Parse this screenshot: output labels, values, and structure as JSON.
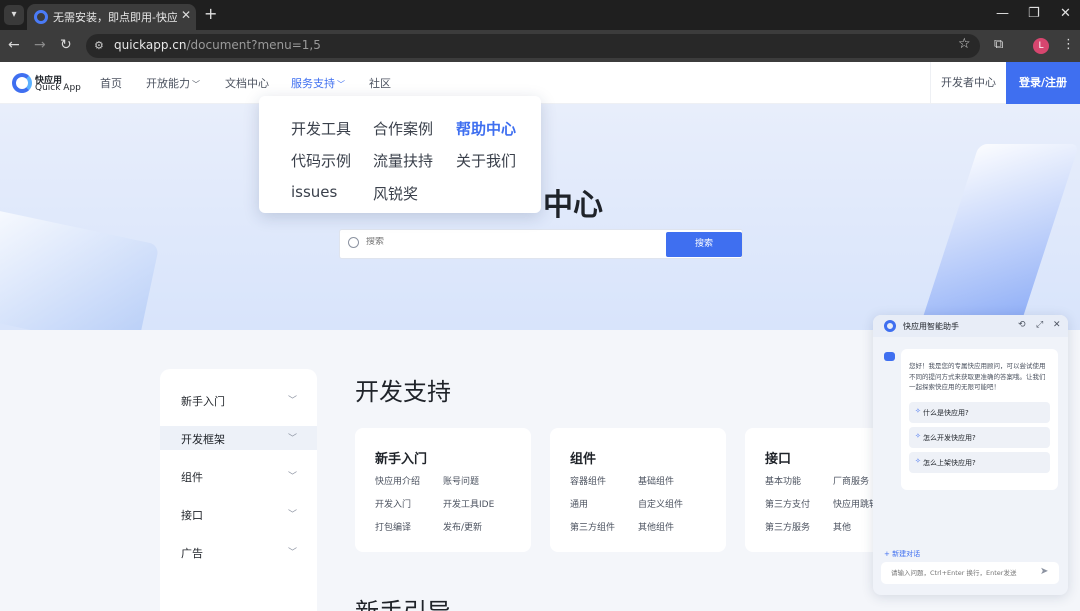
{
  "browser": {
    "tab_title": "无需安装，即点即用-快应用联",
    "url_host": "quickapp.cn",
    "url_path": "/document?menu=1,5",
    "avatar_letter": "L"
  },
  "header": {
    "logo_cn": "快应用",
    "logo_en": "Quick App",
    "nav": [
      {
        "label": "首页",
        "caret": false
      },
      {
        "label": "开放能力",
        "caret": true
      },
      {
        "label": "文档中心",
        "caret": false
      },
      {
        "label": "服务支持",
        "caret": true,
        "active": true
      },
      {
        "label": "社区",
        "caret": false
      }
    ],
    "dev_center": "开发者中心",
    "login": "登录/注册"
  },
  "dropdown": {
    "items": [
      "开发工具",
      "合作案例",
      "帮助中心",
      "代码示例",
      "流量扶持",
      "关于我们",
      "issues",
      "风锐奖"
    ],
    "active_index": 2
  },
  "hero": {
    "title_visible": "中心",
    "search_placeholder": "搜索",
    "search_button": "搜索"
  },
  "sidebar": {
    "items": [
      "新手入门",
      "开发框架",
      "组件",
      "接口",
      "广告"
    ],
    "active_index": 1
  },
  "main": {
    "section_title": "开发支持",
    "section2_title": "新手引导",
    "cards": [
      {
        "title": "新手入门",
        "links": [
          "快应用介绍",
          "账号问题",
          "开发入门",
          "开发工具IDE",
          "打包编译",
          "发布/更新"
        ]
      },
      {
        "title": "组件",
        "links": [
          "容器组件",
          "基础组件",
          "通用",
          "自定义组件",
          "第三方组件",
          "其他组件"
        ]
      },
      {
        "title": "接口",
        "links": [
          "基本功能",
          "厂商服务",
          "第三方支付",
          "快应用跳转",
          "第三方服务",
          "其他"
        ]
      }
    ]
  },
  "assistant": {
    "title": "快应用智能助手",
    "greeting": "您好！我是您的专属快应用顾问，可以尝试使用不同的提问方式来获取更准确的答案哦。让我们一起探索快应用的无限可能吧！",
    "suggestions": [
      "什么是快应用?",
      "怎么开发快应用?",
      "怎么上架快应用?"
    ],
    "new_chat": "新建对话",
    "input_placeholder": "请输入问题，Ctrl+Enter 换行，Enter发送"
  },
  "colors": {
    "accent": "#3f6ff0",
    "hero_bg": "#dce6fb"
  }
}
